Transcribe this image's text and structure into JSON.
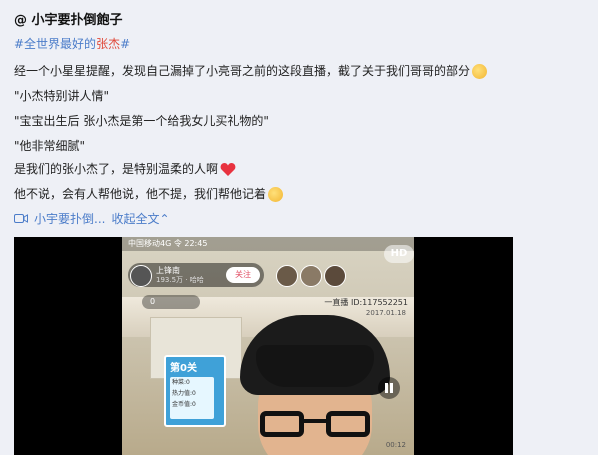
{
  "post": {
    "author": "@ 小宇要扑倒飽子",
    "hashtag_prefix": "#全世界最好的",
    "hashtag_highlight": "张杰",
    "hashtag_suffix": "#",
    "lines": [
      "经一个小星星提醒，发现自己漏掉了小亮哥之前的这段直播，截了关于我们哥哥的部分",
      "\"小杰特别讲人情\"",
      "\"宝宝出生后 张小杰是第一个给我女儿买礼物的\"",
      "\"他非常细腻\"",
      "是我们的张小杰了，是特别温柔的人啊",
      "他不说，会有人帮他说，他不提，我们帮他记着"
    ],
    "video_link": "小宇要扑倒...",
    "collapse_label": "收起全文",
    "collapse_glyph": "⌃"
  },
  "video": {
    "status_text": "中国移动4G 令 22:45",
    "host_name": "上锋南",
    "host_meta": "193.5万 · 哈哈",
    "follow_label": "关注",
    "hd_label": "HD",
    "coin_text": "0",
    "room_id": "一直播 ID:117552251",
    "game_title": "第0关",
    "game_lines": [
      "种菜:0",
      "热力值:0",
      "金币值:0"
    ],
    "date_mark": "2017.01.18",
    "bottom_mark": "00:12"
  },
  "icons": {
    "emoji_1": "smile-emoji-icon",
    "heart": "red-heart-icon",
    "emoji_2": "happy-emoji-icon",
    "video": "video-camera-icon",
    "pause": "pause-icon"
  }
}
